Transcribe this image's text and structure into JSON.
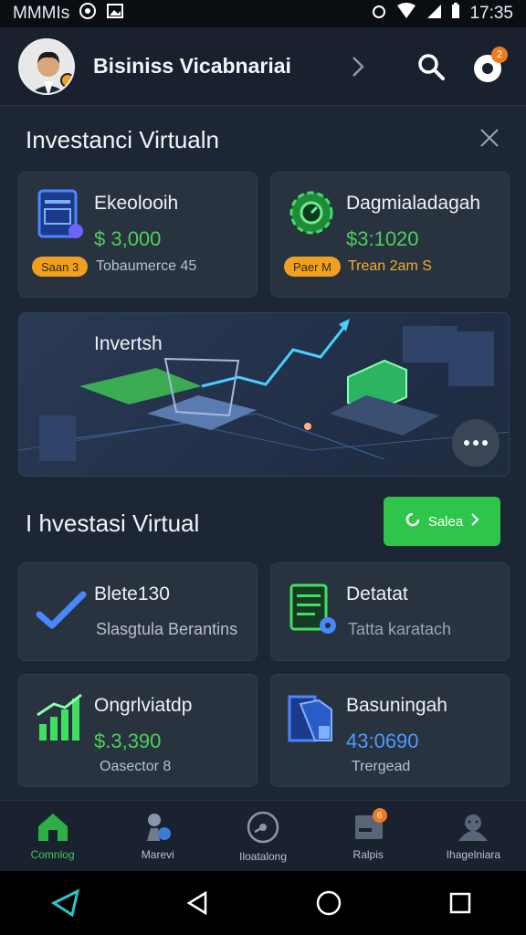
{
  "status_bar": {
    "carrier": "MMMIs",
    "time": "17:35"
  },
  "app_bar": {
    "title": "Bisiniss Vicabnariai"
  },
  "section1": {
    "title": "Investanci Virtualn"
  },
  "cards_top": [
    {
      "title": "Ekeolooih",
      "value": "$ 3,000",
      "pill": "Saan 3",
      "sub": "Tobaumerce 45"
    },
    {
      "title": "Dagmialadagah",
      "value": "$3:1020",
      "pill": "Paer M",
      "sub": "Trean 2am S"
    }
  ],
  "hero": {
    "title": "Invertsh"
  },
  "section2": {
    "title": "I hvestasi Virtual",
    "button_label": "Salea"
  },
  "cards_mid": [
    {
      "title": "Blete130",
      "sub": "Slasgtula Berantins"
    },
    {
      "title": "Detatat",
      "sub": "Tatta karatach"
    }
  ],
  "cards_bottom": [
    {
      "title": "Ongrlviatdp",
      "value": "$.3,390",
      "sub": "Oasector 8"
    },
    {
      "title": "Basuningah",
      "value": "43:0690",
      "sub": "Trergead"
    }
  ],
  "bottom_nav": [
    {
      "label": "Comnlog",
      "icon": "home-icon",
      "active": true
    },
    {
      "label": "Marevi",
      "icon": "people-icon",
      "active": false
    },
    {
      "label": "Iloatalong",
      "icon": "dial-icon",
      "active": false
    },
    {
      "label": "Ralpis",
      "icon": "reports-icon",
      "active": false,
      "badge": "6"
    },
    {
      "label": "Ihagelniara",
      "icon": "user-group-icon",
      "active": false
    }
  ],
  "colors": {
    "accent": "#46c45a",
    "background": "#1d2634",
    "card": "#29323f",
    "badge": "#f07a20"
  }
}
